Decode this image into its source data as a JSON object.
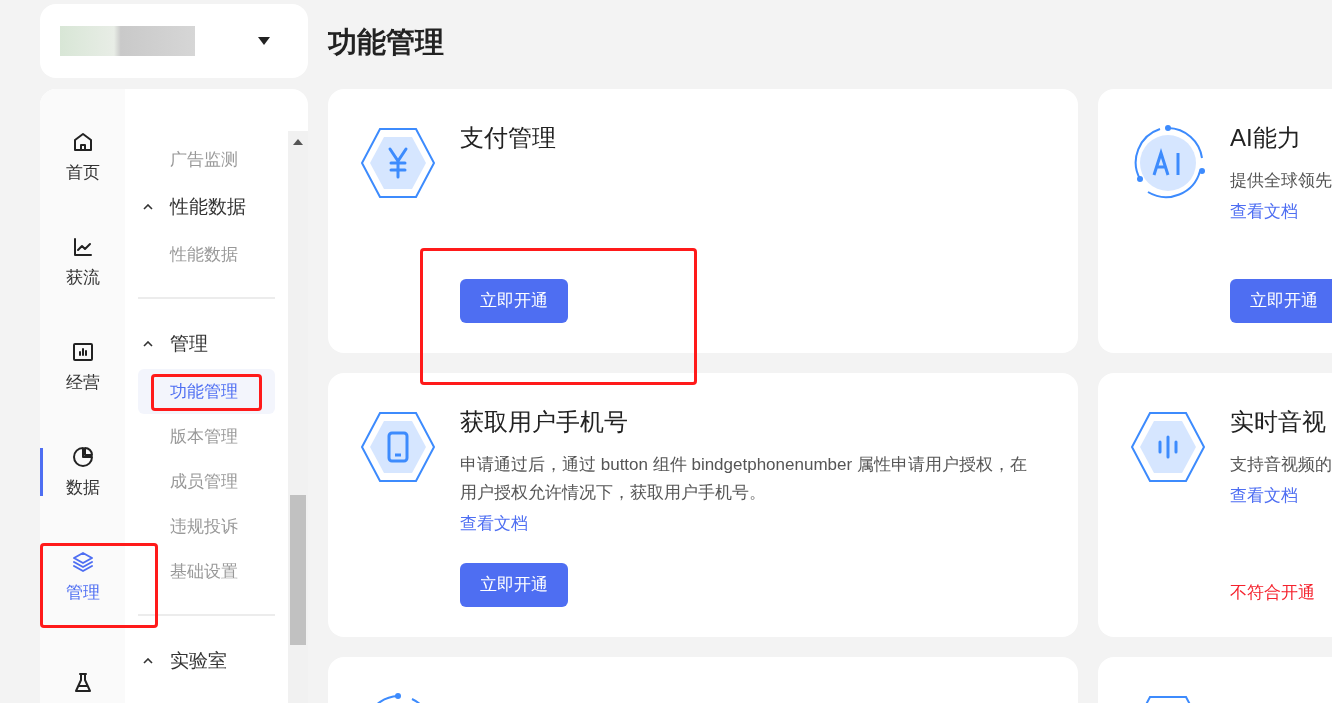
{
  "rail": [
    {
      "label": "首页",
      "selected": false,
      "indicator": false
    },
    {
      "label": "获流",
      "selected": false,
      "indicator": false
    },
    {
      "label": "经营",
      "selected": false,
      "indicator": false
    },
    {
      "label": "数据",
      "selected": false,
      "indicator": true
    },
    {
      "label": "管理",
      "selected": true,
      "indicator": false
    },
    {
      "selected": false,
      "indicator": false
    }
  ],
  "submenu": [
    {
      "kind": "item",
      "label": "广告监测",
      "selected": false
    },
    {
      "kind": "group",
      "label": "性能数据",
      "expanded": true,
      "children": [
        {
          "label": "性能数据",
          "selected": false
        }
      ]
    },
    {
      "kind": "divider"
    },
    {
      "kind": "group",
      "label": "管理",
      "expanded": true,
      "children": [
        {
          "label": "功能管理",
          "selected": true
        },
        {
          "label": "版本管理",
          "selected": false
        },
        {
          "label": "成员管理",
          "selected": false
        },
        {
          "label": "违规投诉",
          "selected": false
        },
        {
          "label": "基础设置",
          "selected": false
        }
      ]
    },
    {
      "kind": "divider"
    },
    {
      "kind": "group",
      "label": "实验室",
      "expanded": true
    }
  ],
  "page_title": "功能管理",
  "cards": [
    {
      "title": "支付管理",
      "action": {
        "kind": "button",
        "label": "立即开通"
      }
    },
    {
      "title": "AI能力",
      "description": "提供全球领先",
      "link": "查看文档",
      "action": {
        "kind": "button",
        "label": "立即开通"
      }
    },
    {
      "title": "获取用户手机号",
      "description": "申请通过后，通过 button 组件 bindgetphonenumber 属性申请用户授权，在用户授权允许情况下，获取用户手机号。",
      "link": "查看文档",
      "action": {
        "kind": "button",
        "label": "立即开通"
      }
    },
    {
      "title": "实时音视",
      "description": "支持音视频的",
      "link": "查看文档",
      "action": {
        "kind": "notice",
        "label": "不符合开通"
      }
    }
  ]
}
